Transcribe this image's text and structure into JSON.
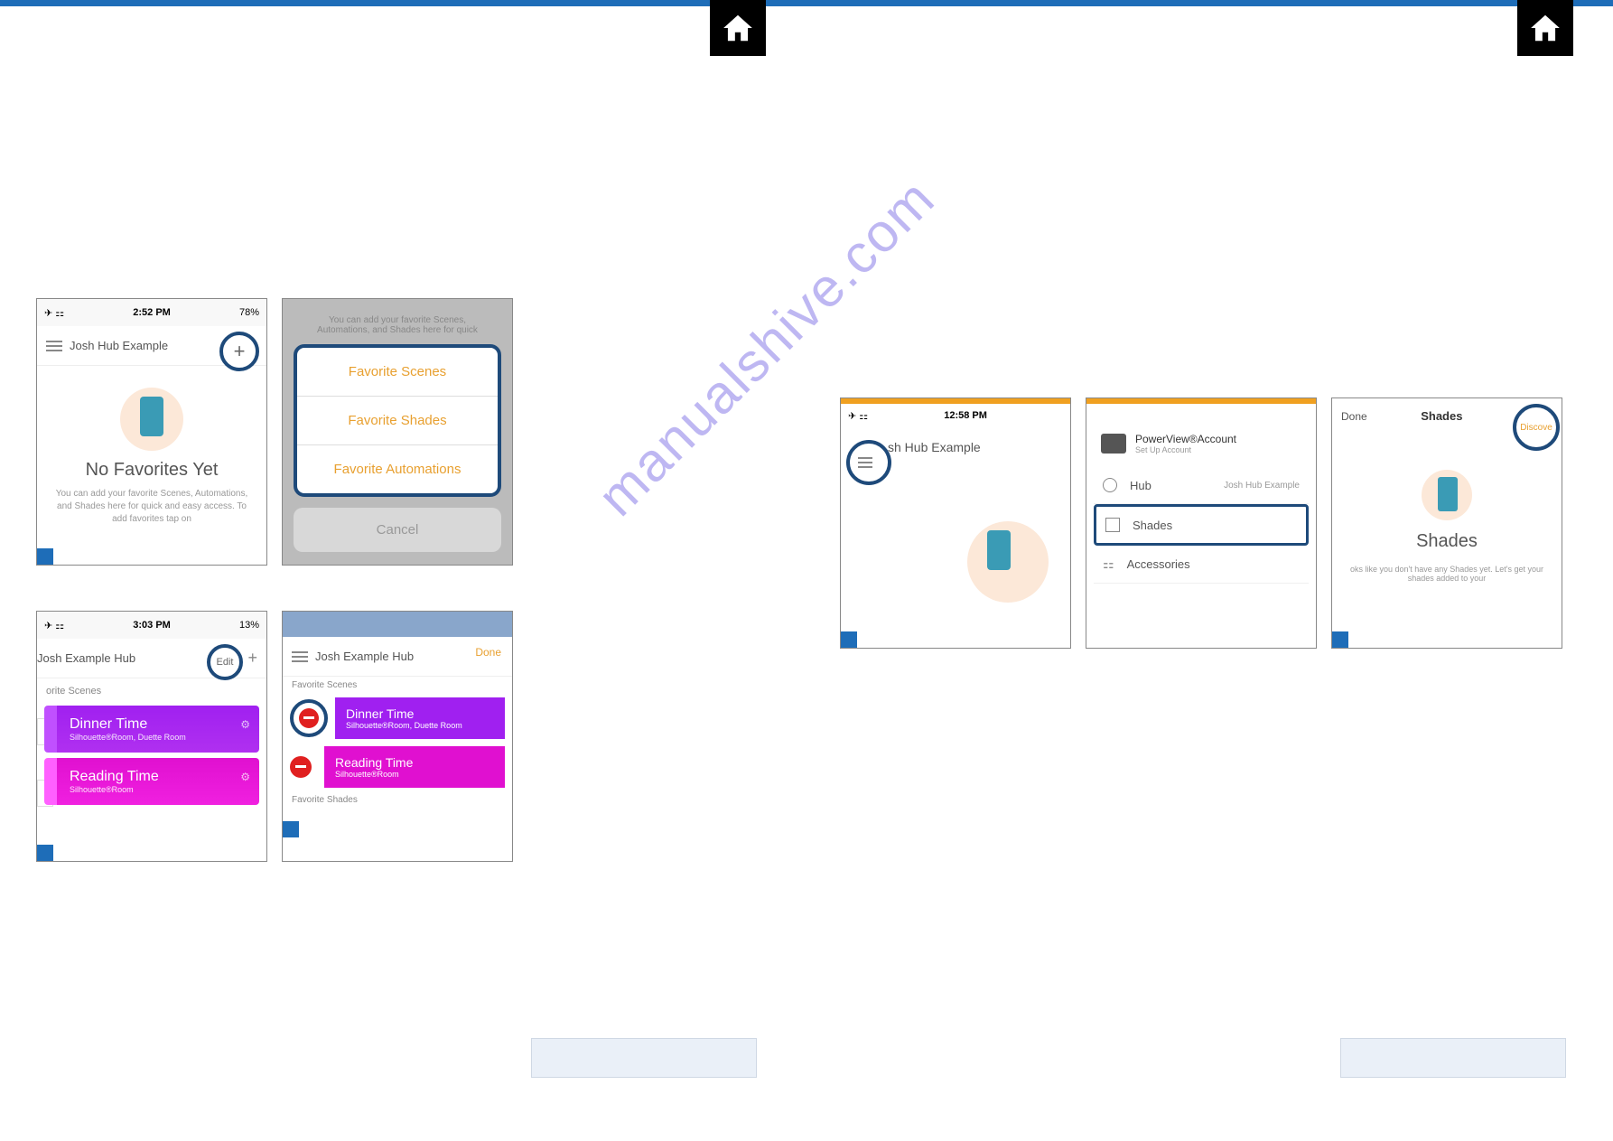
{
  "watermark": "manualshive.com",
  "screenshots": {
    "s1": {
      "time": "2:52 PM",
      "battery": "78%",
      "hub": "Josh Hub Example",
      "title": "No Favorites Yet",
      "sub": "You can add your favorite Scenes, Automations, and Shades here for quick and easy access. To add favorites tap on"
    },
    "s2": {
      "hint": "You can add your favorite Scenes, Automations, and Shades here for quick",
      "opt1": "Favorite Scenes",
      "opt2": "Favorite Shades",
      "opt3": "Favorite Automations",
      "cancel": "Cancel"
    },
    "s3": {
      "time": "3:03 PM",
      "battery": "13%",
      "hub": "Josh Example Hub",
      "edit": "Edit",
      "section": "orite Scenes",
      "card1_t": "Dinner Time",
      "card1_s": "Silhouette®Room, Duette Room",
      "card2_t": "Reading Time",
      "card2_s": "Silhouette®Room"
    },
    "s4": {
      "hub": "Josh Example Hub",
      "done": "Done",
      "sec1": "Favorite Scenes",
      "card1_t": "Dinner Time",
      "card1_s": "Silhouette®Room, Duette Room",
      "card2_t": "Reading Time",
      "card2_s": "Silhouette®Room",
      "sec2": "Favorite Shades"
    },
    "s5": {
      "time": "12:58 PM",
      "hub": "sh Hub Example"
    },
    "s6": {
      "acct_t": "PowerView®Account",
      "acct_s": "Set Up Account",
      "m1": "Hub",
      "m1r": "Josh Hub Example",
      "m2": "Shades",
      "m3": "Accessories"
    },
    "s7": {
      "done": "Done",
      "title": "Shades",
      "discover": "Discove",
      "big": "Shades",
      "sub": "oks like you don't have any Shades yet. Let's get your shades added to your"
    }
  }
}
